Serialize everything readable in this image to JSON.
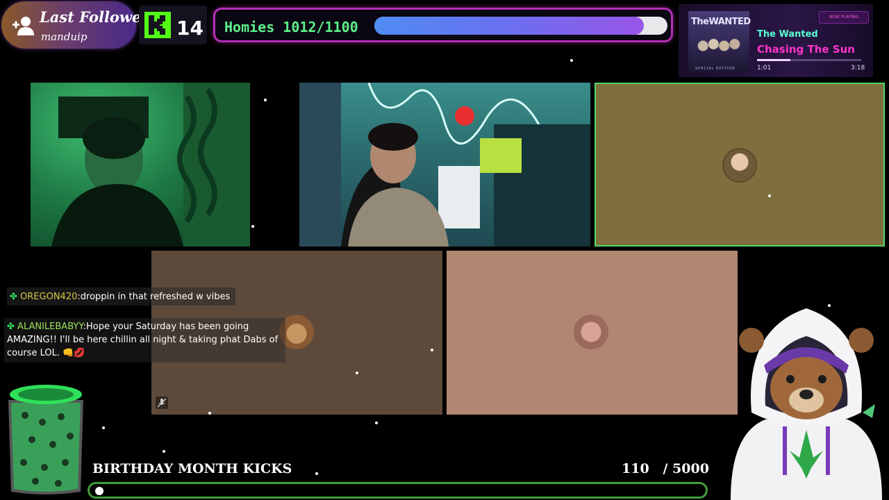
{
  "last_follower": {
    "title": "Last Follower",
    "name": "manduip"
  },
  "kick_count": {
    "value": "14"
  },
  "homies": {
    "label": "Homies 1012/1100",
    "current": 1012,
    "goal": 1100,
    "progress": 0.92
  },
  "now_playing": {
    "album_brand": "TheWANTED",
    "album_sub": "SPECIAL EDITION",
    "badge": "NOW PLAYING",
    "artist": "The Wanted",
    "song": "Chasing The Sun",
    "time_current": "1:01",
    "time_total": "3:18",
    "progress": 0.32
  },
  "chat": [
    {
      "user": "OREGON420",
      "separator": ":",
      "message": "droppin in that refreshed w vibes"
    },
    {
      "user": "ALANILEBABYY",
      "separator": ":",
      "message": "Hope your Saturday has been going AMAZING!! I'll be here chillin all night & taking phat Dabs of course LOL. 👊💋"
    }
  ],
  "goal": {
    "title": "BIRTHDAY MONTH KICKS",
    "count": "110   / 5000",
    "current": 110,
    "target": 5000
  },
  "colors": {
    "accent_purple": "#b22fb5",
    "homies_text": "#5ef08a",
    "goal_border": "#3f9e3a",
    "song_pink": "#ff34c8",
    "artist_cyan": "#58ffd0"
  }
}
